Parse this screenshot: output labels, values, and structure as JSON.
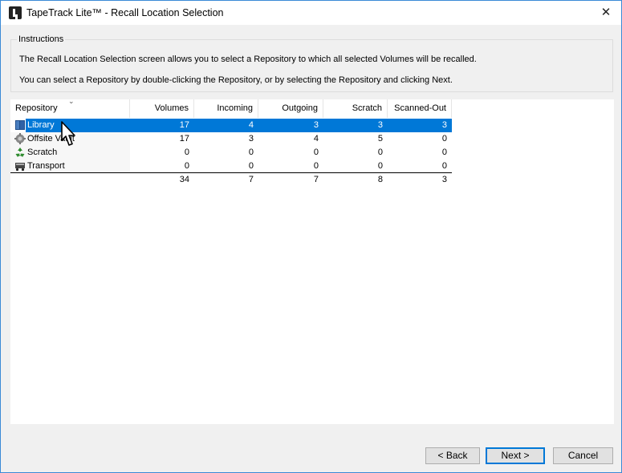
{
  "window": {
    "title": "TapeTrack Lite™ - Recall Location Selection",
    "close_glyph": "✕"
  },
  "instructions": {
    "title": "Instructions",
    "line1": "The Recall Location Selection screen allows you to select a Repository to which all selected Volumes will be recalled.",
    "line2": "You can select a Repository by double-clicking the Repository, or by selecting the Repository and clicking Next."
  },
  "table": {
    "columns": [
      "Repository",
      "Volumes",
      "Incoming",
      "Outgoing",
      "Scratch",
      "Scanned-Out"
    ],
    "sort_glyph": "⌄",
    "rows": [
      {
        "icon": "library-icon",
        "name": "Library",
        "volumes": "17",
        "incoming": "4",
        "outgoing": "3",
        "scratch": "3",
        "scanned_out": "3",
        "selected": true
      },
      {
        "icon": "offsite-vault-icon",
        "name": "Offsite Vault",
        "volumes": "17",
        "incoming": "3",
        "outgoing": "4",
        "scratch": "5",
        "scanned_out": "0",
        "selected": false
      },
      {
        "icon": "scratch-recycle-icon",
        "name": "Scratch",
        "volumes": "0",
        "incoming": "0",
        "outgoing": "0",
        "scratch": "0",
        "scanned_out": "0",
        "selected": false
      },
      {
        "icon": "transport-truck-icon",
        "name": "Transport",
        "volumes": "0",
        "incoming": "0",
        "outgoing": "0",
        "scratch": "0",
        "scanned_out": "0",
        "selected": false
      }
    ],
    "totals": {
      "volumes": "34",
      "incoming": "7",
      "outgoing": "7",
      "scratch": "8",
      "scanned_out": "3"
    }
  },
  "buttons": {
    "back": "< Back",
    "next": "Next >",
    "cancel": "Cancel"
  },
  "colors": {
    "selection": "#0078d7",
    "window_border": "#3a8ad6",
    "dialog_bg": "#f0f0f0"
  }
}
